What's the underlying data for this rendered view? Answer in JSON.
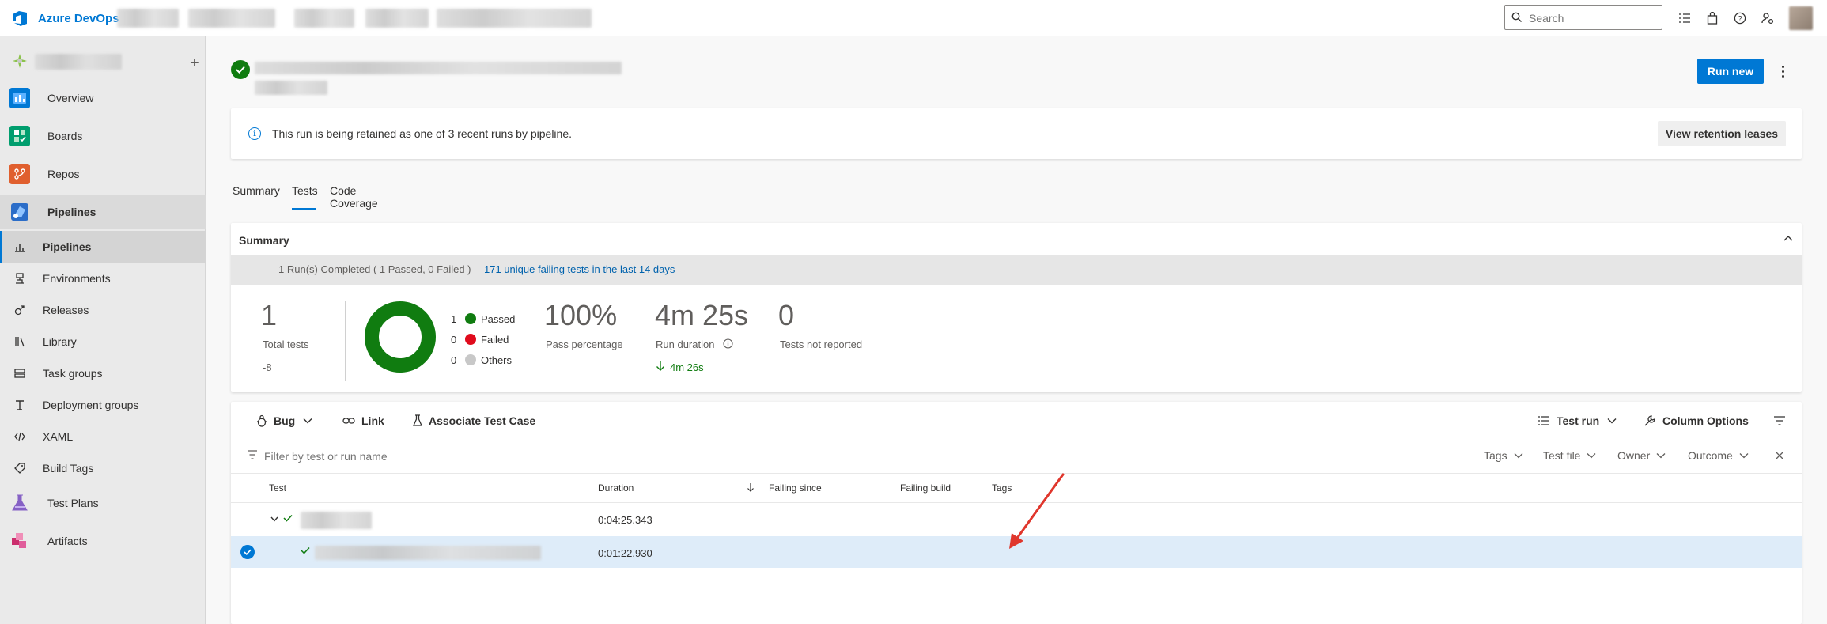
{
  "topbar": {
    "brand": "Azure DevOps",
    "search_placeholder": "Search"
  },
  "sidebar": {
    "add_label": "+",
    "items": [
      {
        "label": "Overview"
      },
      {
        "label": "Boards"
      },
      {
        "label": "Repos"
      },
      {
        "label": "Pipelines"
      }
    ],
    "subitems": [
      {
        "label": "Pipelines"
      },
      {
        "label": "Environments"
      },
      {
        "label": "Releases"
      },
      {
        "label": "Library"
      },
      {
        "label": "Task groups"
      },
      {
        "label": "Deployment groups"
      },
      {
        "label": "XAML"
      },
      {
        "label": "Build Tags"
      }
    ],
    "bottom_items": [
      {
        "label": "Test Plans"
      },
      {
        "label": "Artifacts"
      }
    ]
  },
  "header": {
    "run_new_label": "Run new"
  },
  "banner": {
    "text": "This run is being retained as one of 3 recent runs by pipeline.",
    "button_label": "View retention leases"
  },
  "tabs": [
    {
      "label": "Summary"
    },
    {
      "label": "Tests"
    },
    {
      "label": "Code Coverage"
    }
  ],
  "summary": {
    "title": "Summary",
    "runs_text": "1 Run(s) Completed ( 1 Passed, 0 Failed )",
    "failing_link": "171 unique failing tests in the last 14 days",
    "total_tests": {
      "value": "1",
      "label": "Total tests",
      "delta": "-8"
    },
    "legend": [
      {
        "count": "1",
        "label": "Passed",
        "color": "#107c10"
      },
      {
        "count": "0",
        "label": "Failed",
        "color": "#e00b1c"
      },
      {
        "count": "0",
        "label": "Others",
        "color": "#c8c8c8"
      }
    ],
    "donut_passed_fraction": 1.0,
    "pass_percentage": {
      "value": "100%",
      "label": "Pass percentage"
    },
    "run_duration": {
      "value": "4m 25s",
      "label": "Run duration",
      "delta": "4m 26s"
    },
    "not_reported": {
      "value": "0",
      "label": "Tests not reported"
    }
  },
  "toolbar": {
    "bug": "Bug",
    "link": "Link",
    "associate": "Associate Test Case",
    "test_run": "Test run",
    "column_options": "Column Options"
  },
  "filters": {
    "placeholder": "Filter by test or run name",
    "tags": "Tags",
    "test_file": "Test file",
    "owner": "Owner",
    "outcome": "Outcome"
  },
  "table": {
    "columns": [
      "Test",
      "Duration",
      "Failing since",
      "Failing build",
      "Tags"
    ],
    "rows": [
      {
        "duration": "0:04:25.343"
      },
      {
        "duration": "0:01:22.930"
      }
    ]
  },
  "colors": {
    "accent": "#0078d4",
    "pass": "#107c10",
    "fail": "#e00b1c",
    "annotation_arrow": "#e0362c"
  }
}
